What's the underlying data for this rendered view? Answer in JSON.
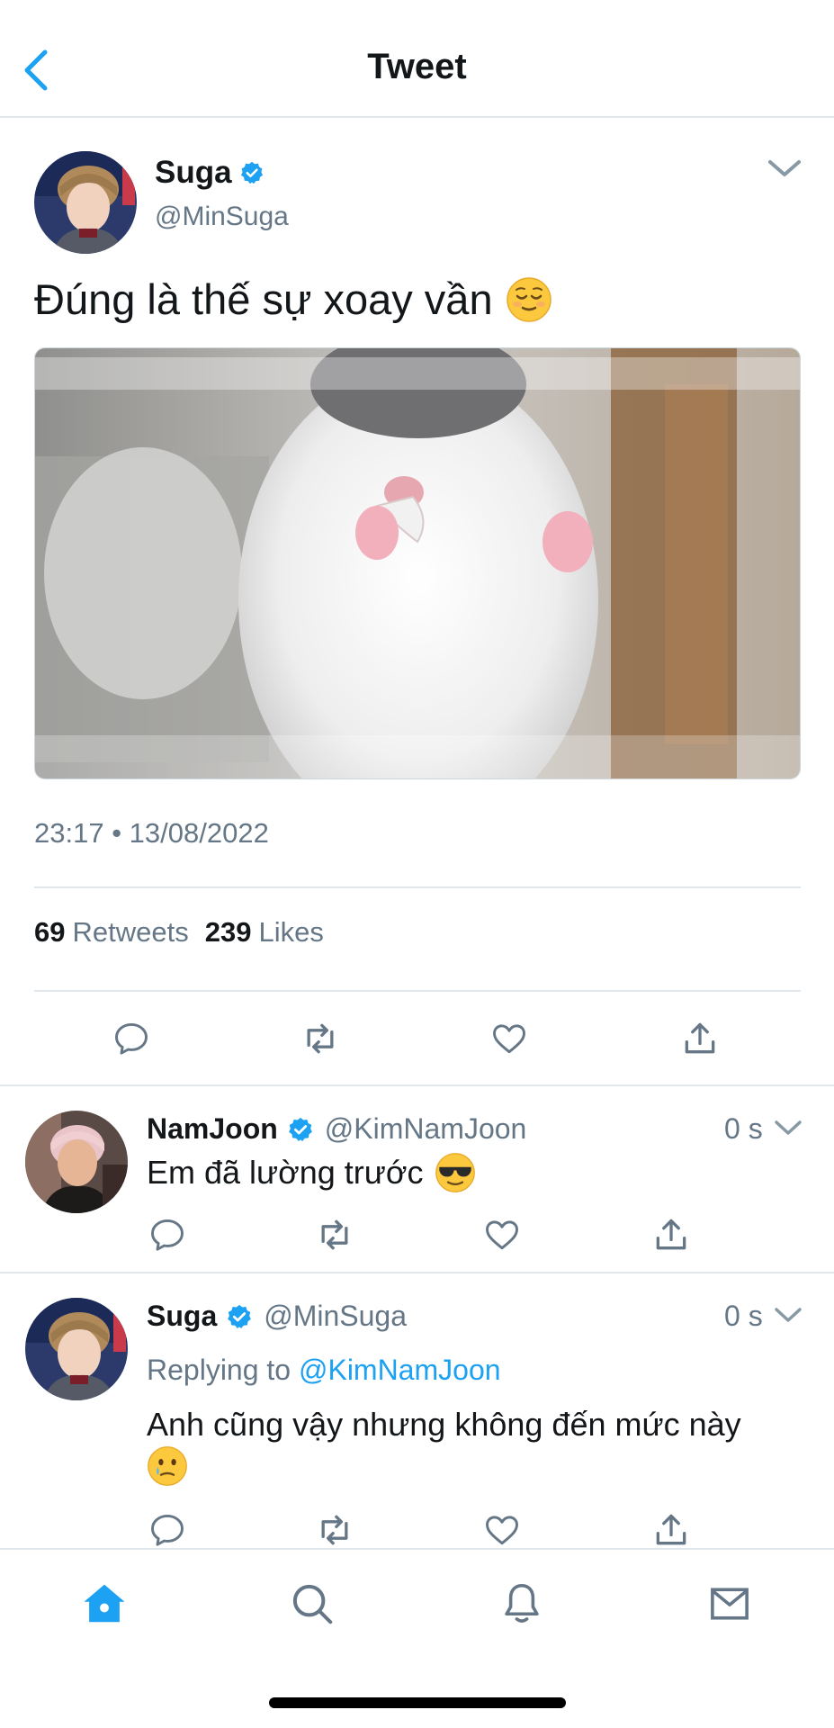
{
  "header": {
    "title": "Tweet"
  },
  "main_tweet": {
    "name": "Suga",
    "handle": "@MinSuga",
    "text": "Đúng là thế sự xoay vần",
    "timestamp": "23:17 • 13/08/2022",
    "retweets_count": "69",
    "retweets_label": "Retweets",
    "likes_count": "239",
    "likes_label": "Likes"
  },
  "replies": [
    {
      "name": "NamJoon",
      "handle": "@KimNamJoon",
      "time": "0 s",
      "text": "Em đã lường trước"
    },
    {
      "name": "Suga",
      "handle": "@MinSuga",
      "time": "0 s",
      "replying_prefix": "Replying to",
      "replying_to": "@KimNamJoon",
      "text": "Anh cũng vậy nhưng không đến mức này"
    }
  ],
  "colors": {
    "accent": "#1da1f2",
    "text_primary": "#14171a",
    "text_secondary": "#657786",
    "divider": "#e1e8ed"
  }
}
